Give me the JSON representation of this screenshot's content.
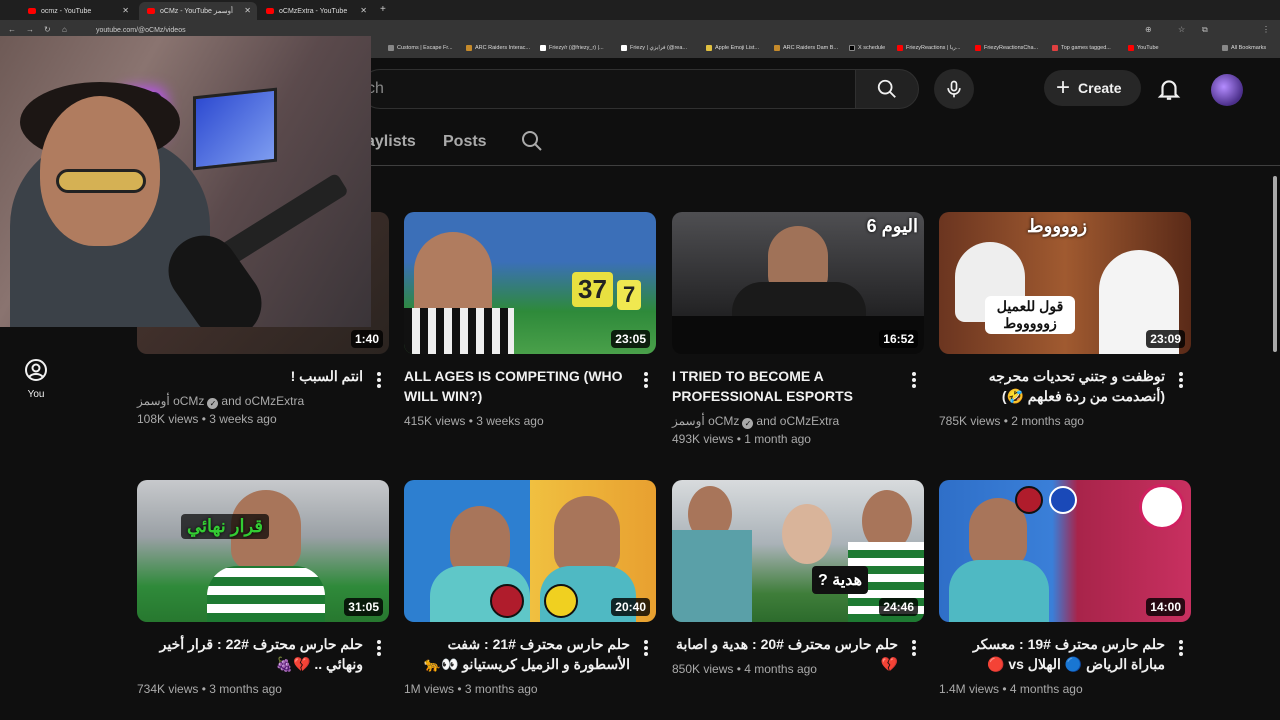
{
  "browser": {
    "tabs": [
      {
        "title": "ocmz - YouTube"
      },
      {
        "title": "oCMz - YouTube أوسمز"
      },
      {
        "title": "oCMzExtra - YouTube"
      }
    ],
    "url": "youtube.com/@oCMz/videos",
    "bookmarks": [
      "Customs | Escape Fr...",
      "ARC Raiders Interac...",
      "Friezy/r (@friezy_r) |...",
      "Friezy | فرايزي (@rea...",
      "Apple Emoji List...",
      "ARC Raiders Dam B...",
      "X schedule",
      "FriezyReactions | ريا...",
      "FriezyReactionsCha...",
      "Top games tagged...",
      "YouTube",
      "All Bookmarks"
    ]
  },
  "header": {
    "search_placeholder": "ch",
    "create_label": "Create"
  },
  "channel_tabs": [
    "aylists",
    "Posts"
  ],
  "sidebar": {
    "you_label": "You"
  },
  "videos": [
    {
      "title": "انتم السبب !",
      "duration": "1:40",
      "channel": "أوسمز oCMz",
      "collab": "and oCMzExtra",
      "views": "108K views",
      "age": "3 weeks ago",
      "rtl": true
    },
    {
      "title": "ALL AGES IS COMPETING (WHO WILL WIN?)",
      "duration": "23:05",
      "views": "415K views",
      "age": "3 weeks ago"
    },
    {
      "title": "I TRIED TO BECOME A PROFESSIONAL ESPORTS PLAYER",
      "duration": "16:52",
      "channel": "أوسمز oCMz",
      "collab": "and oCMzExtra",
      "views": "493K views",
      "age": "1 month ago",
      "thumb_text": "اليوم 6"
    },
    {
      "title": "توظفت و جتني تحديات محرجه (أنصدمت من ردة فعلهم 🤣)",
      "duration": "23:09",
      "views": "785K views",
      "age": "2 months ago",
      "rtl": true,
      "thumb_text": "زووووط",
      "thumb_text2": "قول للعميل زوووووط"
    },
    {
      "title": "حلم حارس محترف #22 : قرار أخير ونهائي .. 💔🍇",
      "duration": "31:05",
      "views": "734K views",
      "age": "3 months ago",
      "rtl": true,
      "thumb_text": "قرار نهائي"
    },
    {
      "title": "حلم حارس محترف #21 : شفت الأسطورة و الزميل كريستيانو 👀🐆",
      "duration": "20:40",
      "views": "1M views",
      "age": "3 months ago",
      "rtl": true
    },
    {
      "title": "حلم حارس محترف #20 : هدية و اصابة 💔",
      "duration": "24:46",
      "views": "850K views",
      "age": "4 months ago",
      "rtl": true,
      "thumb_text": "هدية ?"
    },
    {
      "title": "حلم حارس محترف #19 : معسكر مباراة الرياض 🔵 الهلال vs 🔴",
      "duration": "14:00",
      "views": "1.4M views",
      "age": "4 months ago",
      "rtl": true
    }
  ],
  "colors": {
    "bg": "#0f0f0f",
    "text": "#f1f1f1",
    "muted": "#aaaaaa",
    "brand": "#ff0000"
  }
}
